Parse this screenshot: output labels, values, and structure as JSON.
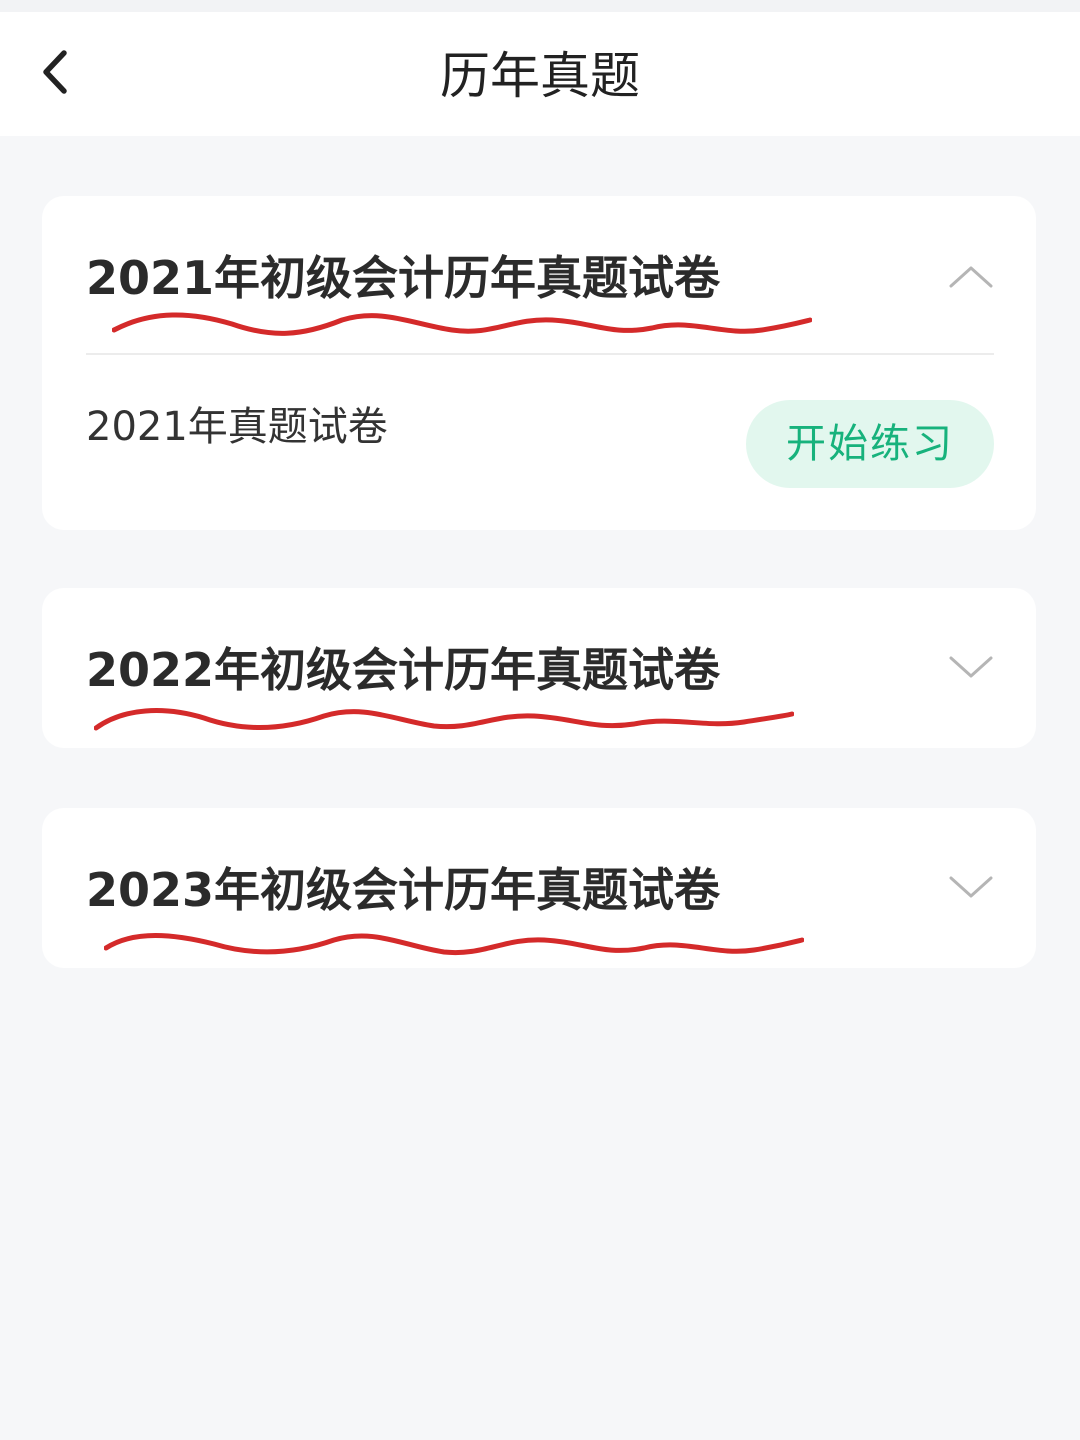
{
  "header": {
    "title": "历年真题",
    "back_icon": "chevron-left-icon"
  },
  "annotation_color": "#d42a2a",
  "accent_color": "#17b27c",
  "papers": [
    {
      "title": "2021年初级会计历年真题试卷",
      "expanded": true,
      "toggle_icon": "chevron-up-icon",
      "items": [
        {
          "label": "2021年真题试卷",
          "action_label": "开始练习"
        }
      ]
    },
    {
      "title": "2022年初级会计历年真题试卷",
      "expanded": false,
      "toggle_icon": "chevron-down-icon"
    },
    {
      "title": "2023年初级会计历年真题试卷",
      "expanded": false,
      "toggle_icon": "chevron-down-icon"
    }
  ]
}
